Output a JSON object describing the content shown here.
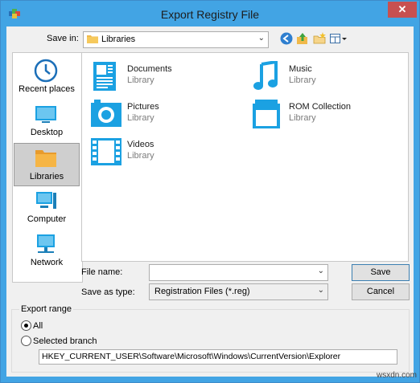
{
  "window": {
    "title": "Export Registry File",
    "close_label": "✕"
  },
  "toolbar": {
    "savein_label": "Save in:",
    "savein_value": "Libraries",
    "icons": [
      "back-icon",
      "up-folder-icon",
      "new-folder-icon",
      "view-menu-icon"
    ]
  },
  "places": [
    {
      "label": "Recent places",
      "icon": "clock-icon"
    },
    {
      "label": "Desktop",
      "icon": "desktop-icon"
    },
    {
      "label": "Libraries",
      "icon": "libraries-icon",
      "selected": true
    },
    {
      "label": "Computer",
      "icon": "computer-icon"
    },
    {
      "label": "Network",
      "icon": "network-icon"
    }
  ],
  "files": [
    {
      "name": "Documents",
      "type": "Library",
      "icon": "document-icon"
    },
    {
      "name": "Music",
      "type": "Library",
      "icon": "music-icon"
    },
    {
      "name": "Pictures",
      "type": "Library",
      "icon": "camera-icon"
    },
    {
      "name": "ROM Collection",
      "type": "Library",
      "icon": "folder-library-icon"
    },
    {
      "name": "Videos",
      "type": "Library",
      "icon": "video-icon"
    }
  ],
  "form": {
    "filename_label": "File name:",
    "filename_value": "",
    "type_label": "Save as type:",
    "type_value": "Registration Files (*.reg)",
    "save_label": "Save",
    "cancel_label": "Cancel"
  },
  "export": {
    "title": "Export range",
    "all_label": "All",
    "all_checked": true,
    "selected_label": "Selected branch",
    "branch_value": "HKEY_CURRENT_USER\\Software\\Microsoft\\Windows\\CurrentVersion\\Explorer"
  },
  "watermark": "wsxdn.com",
  "colors": {
    "accent": "#1ba1e2",
    "titlebar": "#42a4e4",
    "close": "#c75050"
  }
}
